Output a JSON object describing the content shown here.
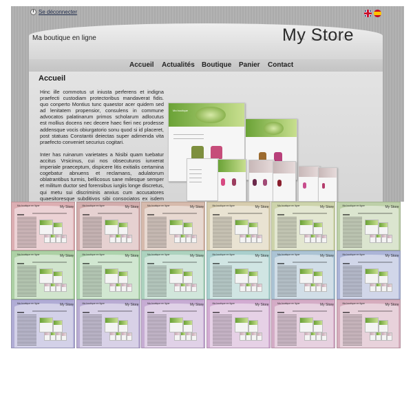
{
  "header": {
    "logout_label": "Se déconnecter",
    "tagline": "Ma boutique en ligne",
    "logo_text": "My Store",
    "languages": [
      "English",
      "Español"
    ]
  },
  "nav": {
    "items": [
      "Accueil",
      "Actualités",
      "Boutique",
      "Panier",
      "Contact"
    ]
  },
  "main": {
    "heading": "Accueil",
    "paragraphs": [
      "Hinc ille commotus ut iniusta perferens et indigna praefecti custodiam protectoribus mandaverat fidis. quo conperto Montius tunc quaestor acer quidem sed ad lenitatem propensior, consulens in commune advocatos palatinarum primos scholarum adlocutus est mollius docens nec decere haec fieri nec prodesse addensque vocis obiurgatorio sonu quod si id placeret, post statuas Constantii deiectas super adimenda vita praefecto conveniet securius cogitari.",
      "Inter has ruinarum varietates a Nisibi quam tuebatur accitus Vrsicinus, cui nos obsecuturos iunxerat imperiale praeceptum, dispicere litis exitialis certamina cogebatur abnuens et reclamans, adulatorum oblatrantibus turmis, bellicosus sane milesque semper et militum ductor sed forensibus iurgiis longe discretus, qui metu sui discriminis anxius cum accusatores quaesitoresque subditivos sibi consociatos ex isdem foveis cerneret emergentes, quae clam palamve agitabantur, occultis Constantium litteris edocebat inplorans subsidia, quorum metu tumor notissimus Caesaris exhalaret."
    ]
  },
  "collage": {
    "window_title": "Ma boutique"
  },
  "theme_grid": {
    "tile_title": "Ma boutique en ligne",
    "tile_logo": "My Store",
    "colors": [
      "#dcaeb2",
      "#d2acac",
      "#d6baac",
      "#d7cdae",
      "#cdd4ab",
      "#bdd0a8",
      "#acd0a4",
      "#acd3ac",
      "#acd2be",
      "#a9cfcd",
      "#abc3d4",
      "#abb4d7",
      "#b0acd5",
      "#b9acd3",
      "#c6acd3",
      "#d2acd2",
      "#d4acc6",
      "#d6adbd"
    ]
  }
}
